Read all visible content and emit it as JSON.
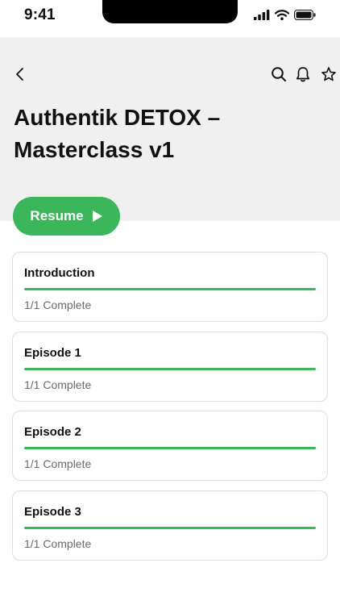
{
  "status_bar": {
    "time": "9:41"
  },
  "course": {
    "title": "Authentik DETOX – Masterclass v1"
  },
  "resume": {
    "label": "Resume"
  },
  "colors": {
    "accent": "#3cb65a",
    "header_bg": "#f0f0f0"
  },
  "icons": {
    "back": "chevron-left-icon",
    "search": "search-icon",
    "notifications": "bell-icon",
    "favorite": "star-icon"
  },
  "sections": [
    {
      "title": "Introduction",
      "status": "1/1 Complete",
      "progress": 1.0
    },
    {
      "title": "Episode 1",
      "status": "1/1 Complete",
      "progress": 1.0
    },
    {
      "title": "Episode 2",
      "status": "1/1 Complete",
      "progress": 1.0
    },
    {
      "title": "Episode 3",
      "status": "1/1 Complete",
      "progress": 1.0
    }
  ]
}
